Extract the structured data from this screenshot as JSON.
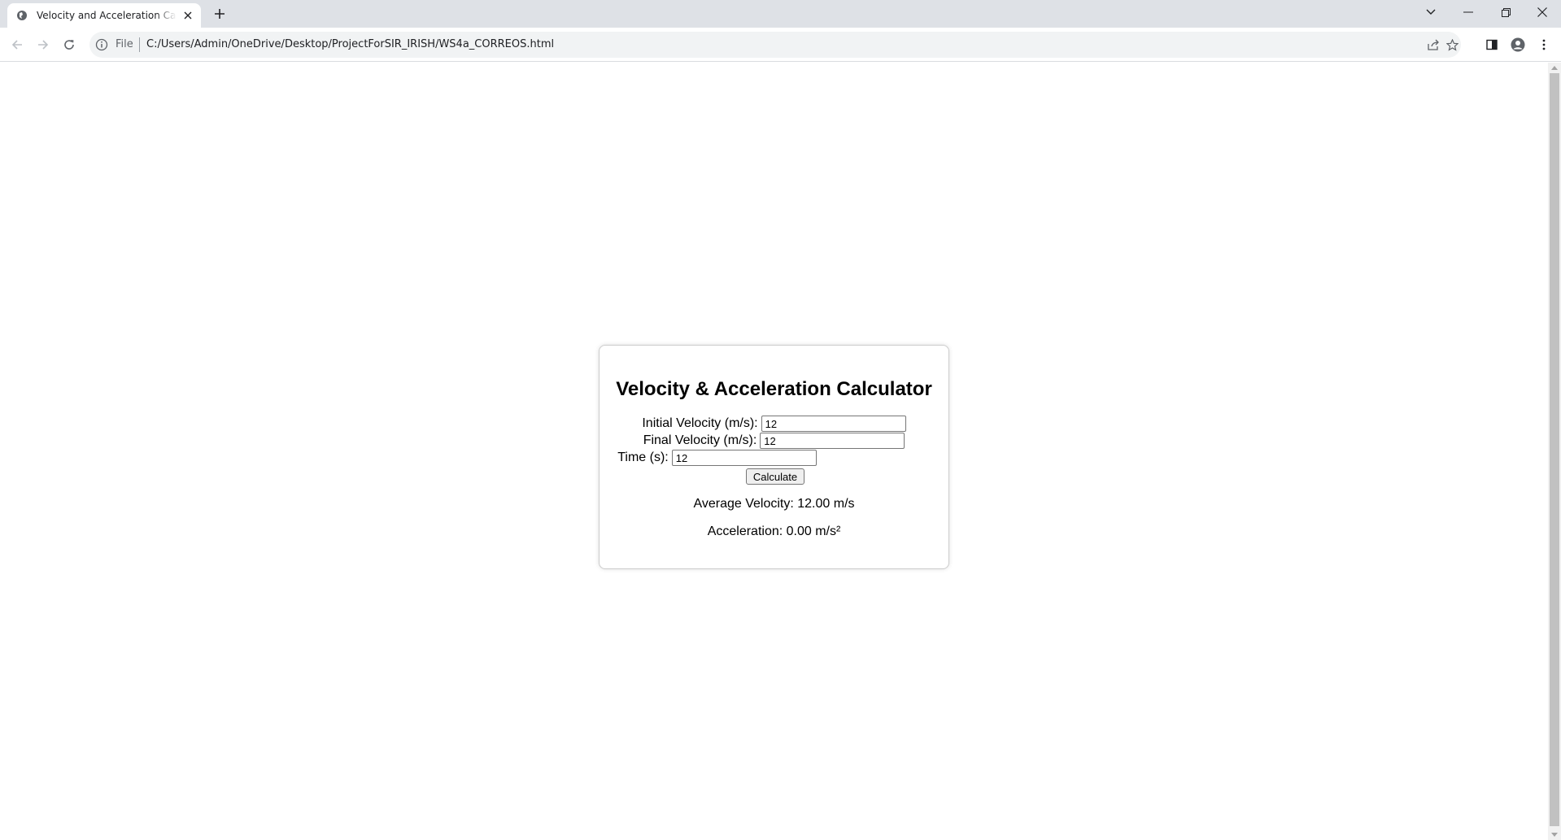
{
  "browser": {
    "tab_title": "Velocity and Acceleration Calculator",
    "omnibox_scheme": "File",
    "url": "C:/Users/Admin/OneDrive/Desktop/ProjectForSIR_IRISH/WS4a_CORREOS.html"
  },
  "page": {
    "title": "Velocity & Acceleration Calculator",
    "initial_velocity_label": "Initial Velocity (m/s):",
    "initial_velocity_value": "12",
    "final_velocity_label": "Final Velocity (m/s):",
    "final_velocity_value": "12",
    "time_label": "Time (s):",
    "time_value": "12",
    "calculate_label": "Calculate",
    "average_velocity_text": "Average Velocity: 12.00 m/s",
    "acceleration_text": "Acceleration: 0.00 m/s²"
  }
}
